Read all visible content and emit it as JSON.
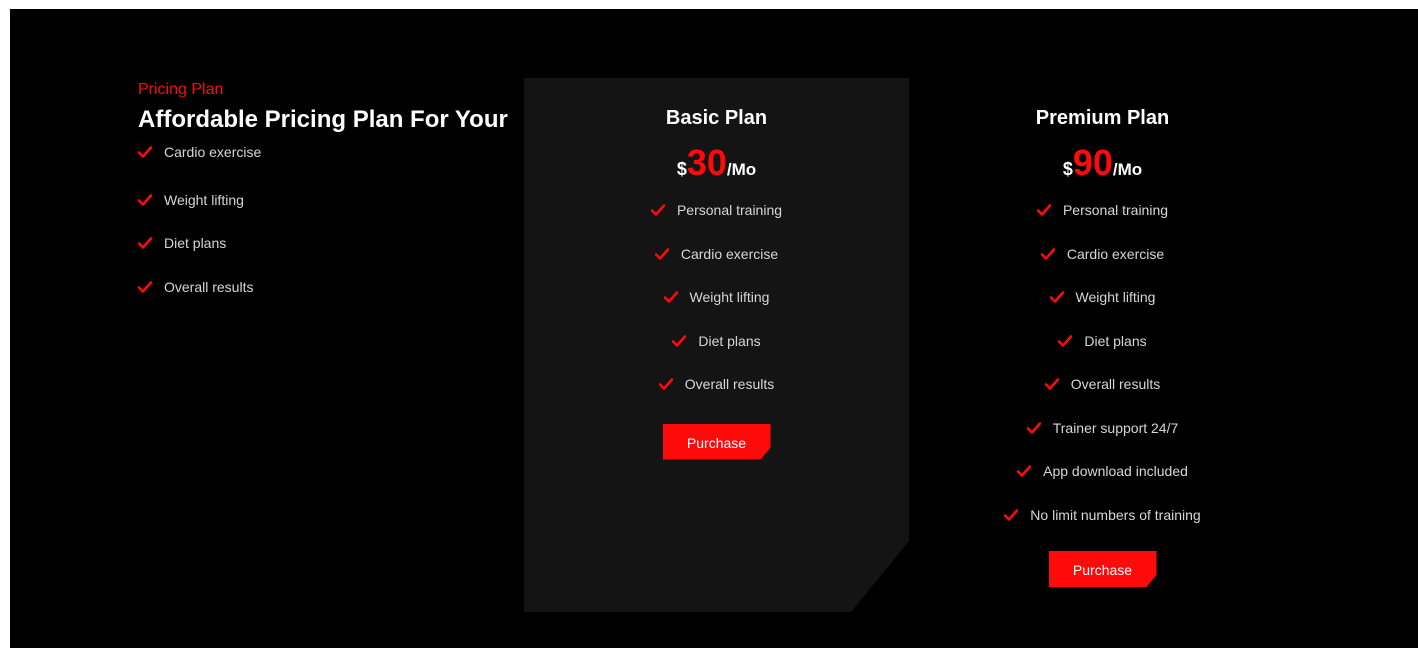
{
  "intro": {
    "eyebrow": "Pricing Plan",
    "heading": "Affordable Pricing Plan For Your",
    "features": [
      "Cardio exercise",
      "Weight lifting",
      "Diet plans",
      "Overall results"
    ]
  },
  "plans": [
    {
      "name": "Basic Plan",
      "currency": "$",
      "amount": "30",
      "period": "/Mo",
      "features": [
        "Personal training",
        "Cardio exercise",
        "Weight lifting",
        "Diet plans",
        "Overall results"
      ],
      "button": "Purchase"
    },
    {
      "name": "Premium Plan",
      "currency": "$",
      "amount": "90",
      "period": "/Mo",
      "features": [
        "Personal training",
        "Cardio exercise",
        "Weight lifting",
        "Diet plans",
        "Overall results",
        "Trainer support 24/7",
        "App download included",
        "No limit numbers of training"
      ],
      "button": "Purchase"
    }
  ],
  "icons": {
    "feature_check": "check-icon"
  },
  "colors": {
    "accent": "#ff0a0a",
    "background": "#000000",
    "card": "#141414",
    "text": "#d6d6d6"
  }
}
